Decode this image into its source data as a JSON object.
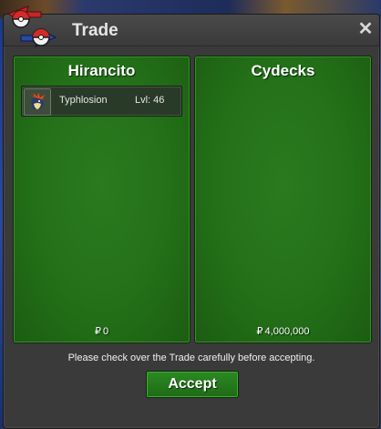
{
  "window": {
    "title": "Trade",
    "close_label": "✕"
  },
  "left_panel": {
    "trainer": "Hirancito",
    "pokemon": [
      {
        "name": "Typhlosion",
        "level_label": "Lvl: 46"
      }
    ],
    "money_symbol": "₽",
    "money": "0"
  },
  "right_panel": {
    "trainer": "Cydecks",
    "pokemon": [],
    "money_symbol": "₽",
    "money": "4,000,000"
  },
  "footer": {
    "notice": "Please check over the Trade carefully before accepting.",
    "accept_label": "Accept"
  },
  "colors": {
    "panel_green": "#237018",
    "window_bg": "#3a3a3a",
    "accent_red": "#c0282a",
    "accent_blue": "#2a4aa8"
  }
}
